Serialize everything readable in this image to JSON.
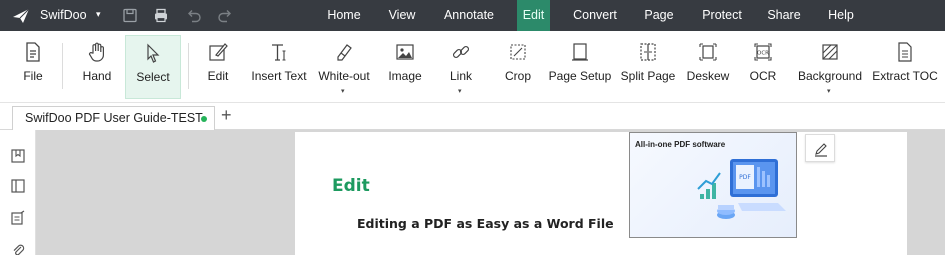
{
  "app": {
    "name": "SwifDoo"
  },
  "menu": [
    {
      "label": "Home",
      "active": false
    },
    {
      "label": "View",
      "active": false
    },
    {
      "label": "Annotate",
      "active": false
    },
    {
      "label": "Edit",
      "active": true
    },
    {
      "label": "Convert",
      "active": false
    },
    {
      "label": "Page",
      "active": false
    },
    {
      "label": "Protect",
      "active": false
    },
    {
      "label": "Share",
      "active": false
    },
    {
      "label": "Help",
      "active": false
    }
  ],
  "ribbon": {
    "file": "File",
    "hand": "Hand",
    "select": "Select",
    "edit": "Edit",
    "insert_text": "Insert Text",
    "white_out": "White-out",
    "image": "Image",
    "link": "Link",
    "crop": "Crop",
    "page_setup": "Page Setup",
    "split_page": "Split Page",
    "deskew": "Deskew",
    "ocr": "OCR",
    "background": "Background",
    "extract_toc": "Extract TOC",
    "active_tool": "Select"
  },
  "tab": {
    "title": "SwifDoo PDF User Guide-TEST",
    "unsaved_dot_color": "#25b35a",
    "new_tab_symbol": "+"
  },
  "document": {
    "heading": "Edit",
    "subheading": "Editing a PDF as Easy as a Word File",
    "banner_text": "All-in-one PDF software"
  },
  "colors": {
    "titlebar": "#373b41",
    "active_menu": "#2c8a6a",
    "heading_green": "#1d9a5f"
  }
}
